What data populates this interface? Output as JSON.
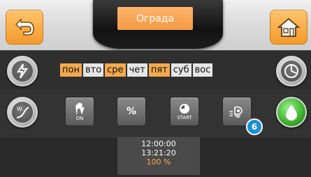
{
  "header": {
    "title": "Ограда"
  },
  "days": [
    {
      "label": "пон",
      "active": true
    },
    {
      "label": "вто",
      "active": false
    },
    {
      "label": "сре",
      "active": true
    },
    {
      "label": "чет",
      "active": false
    },
    {
      "label": "пят",
      "active": true
    },
    {
      "label": "суб",
      "active": false
    },
    {
      "label": "вос",
      "active": false
    }
  ],
  "controls": {
    "manual_on_label": "ON",
    "percent_label": "%",
    "start_label": "START",
    "sprinkler_count": "6"
  },
  "info": {
    "time1": "12:00:00",
    "time2": "13:21:20",
    "percent": "100 %"
  },
  "colors": {
    "accent": "#f4a94d",
    "badge": "#1a8fd8",
    "green": "#3cae2a"
  }
}
